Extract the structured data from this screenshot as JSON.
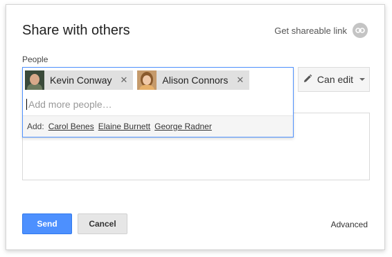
{
  "dialog": {
    "title": "Share with others",
    "share_link_label": "Get shareable link"
  },
  "people": {
    "label": "People",
    "chips": [
      {
        "name": "Kevin Conway",
        "remove": "✕"
      },
      {
        "name": "Alison Connors",
        "remove": "✕"
      }
    ],
    "input_placeholder": "Add more people…",
    "suggestions_label": "Add:",
    "suggestions": [
      "Carol Benes",
      "Elaine Burnett",
      "George Radner"
    ]
  },
  "permission": {
    "label": "Can edit"
  },
  "footer": {
    "send_label": "Send",
    "cancel_label": "Cancel",
    "advanced_label": "Advanced"
  },
  "colors": {
    "accent": "#4d90fe",
    "focus_border": "#4d90fe",
    "chip_bg": "#e0e0e0"
  },
  "icons": {
    "link": "link-icon",
    "pencil": "pencil-icon",
    "dropdown": "chevron-down-icon"
  }
}
